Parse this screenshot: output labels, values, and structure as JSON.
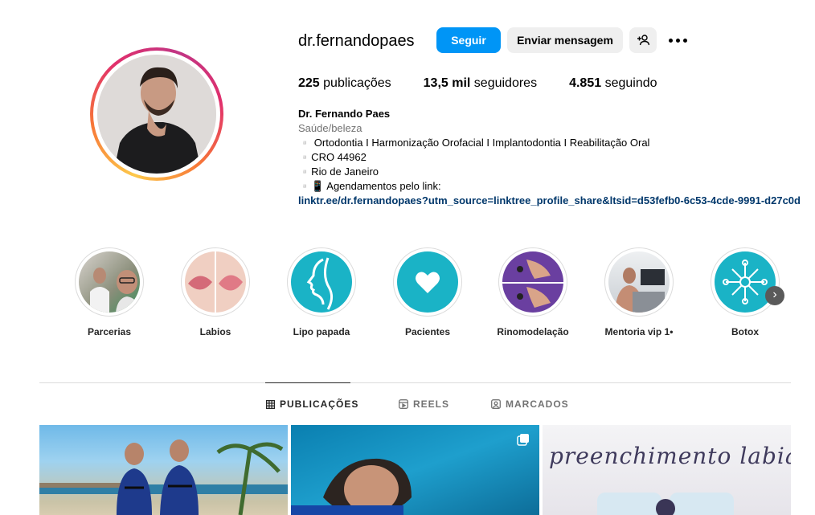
{
  "profile": {
    "username": "dr.fernandopaes",
    "follow_label": "Seguir",
    "message_label": "Enviar mensagem",
    "stats": {
      "posts_count": "225",
      "posts_label": " publicações",
      "followers_count": "13,5 mil",
      "followers_label": " seguidores",
      "following_count": "4.851",
      "following_label": " seguindo"
    },
    "bio": {
      "name": "Dr. Fernando Paes",
      "category": "Saúde/beleza",
      "line1": "▫️ Ortodontia I Harmonização Orofacial I Implantodontia I Reabilitação Oral",
      "line2": "▫️CRO 44962",
      "line3": "▫️Rio de Janeiro",
      "line4": "▫️📱 Agendamentos pelo link:",
      "link": "linktr.ee/dr.fernandopaes?utm_source=linktree_profile_share&ltsid=d53fefb0-6c53-4cde-9991-d27c0d"
    }
  },
  "highlights": [
    {
      "label": "Parcerias"
    },
    {
      "label": "Labios"
    },
    {
      "label": "Lipo papada"
    },
    {
      "label": "Pacientes"
    },
    {
      "label": "Rinomodelação"
    },
    {
      "label": "Mentoria vip 1•"
    },
    {
      "label": "Botox"
    }
  ],
  "tabs": [
    {
      "label": "PUBLICAÇÕES"
    },
    {
      "label": "REELS"
    },
    {
      "label": "MARCADOS"
    }
  ],
  "posts": {
    "post3_title": "preenchimento labial"
  },
  "colors": {
    "accent": "#0095f6",
    "teal": "#1ab3c6",
    "link": "#00376b"
  }
}
